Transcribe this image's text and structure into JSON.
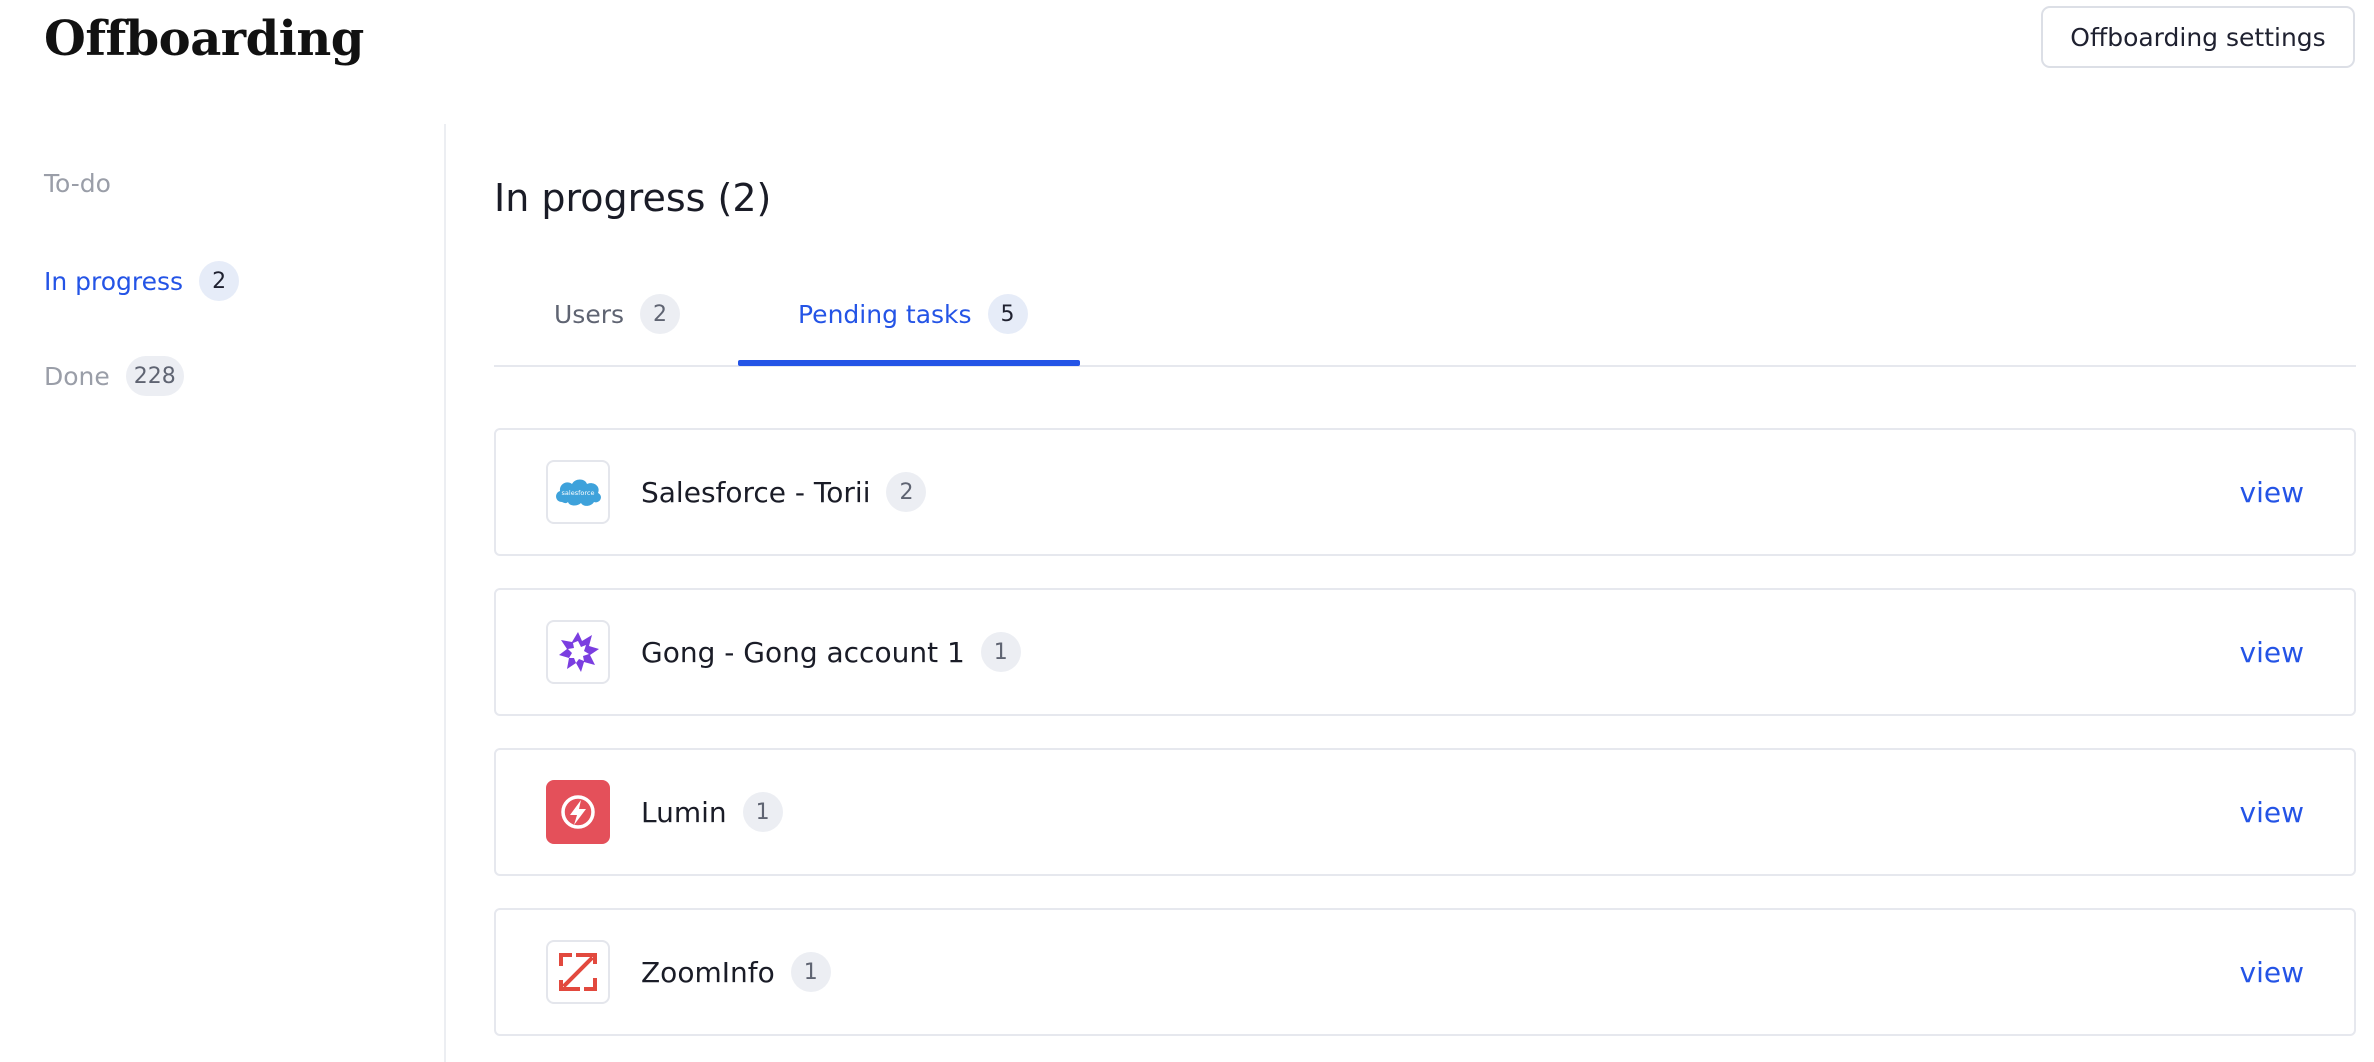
{
  "page": {
    "title": "Offboarding"
  },
  "header": {
    "settings_label": "Offboarding settings"
  },
  "sidebar": {
    "items": [
      {
        "label": "To-do",
        "count": null,
        "active": false
      },
      {
        "label": "In progress",
        "count": "2",
        "active": true
      },
      {
        "label": "Done",
        "count": "228",
        "active": false
      }
    ]
  },
  "main": {
    "section_title": "In progress (2)",
    "tabs": [
      {
        "label": "Users",
        "count": "2",
        "active": false
      },
      {
        "label": "Pending tasks",
        "count": "5",
        "active": true
      }
    ],
    "apps": [
      {
        "name": "Salesforce - Torii",
        "count": "2",
        "icon": "salesforce-icon",
        "view_label": "view",
        "logo_text": "salesforce"
      },
      {
        "name": "Gong - Gong account 1",
        "count": "1",
        "icon": "gong-icon",
        "view_label": "view"
      },
      {
        "name": "Lumin",
        "count": "1",
        "icon": "lumin-icon",
        "view_label": "view"
      },
      {
        "name": "ZoomInfo",
        "count": "1",
        "icon": "zoominfo-icon",
        "view_label": "view"
      }
    ]
  },
  "colors": {
    "accent": "#2454e6",
    "salesforce": "#3ea2db",
    "gong": "#7b3ee0",
    "lumin": "#e4505a",
    "zoominfo": "#e2493e"
  }
}
